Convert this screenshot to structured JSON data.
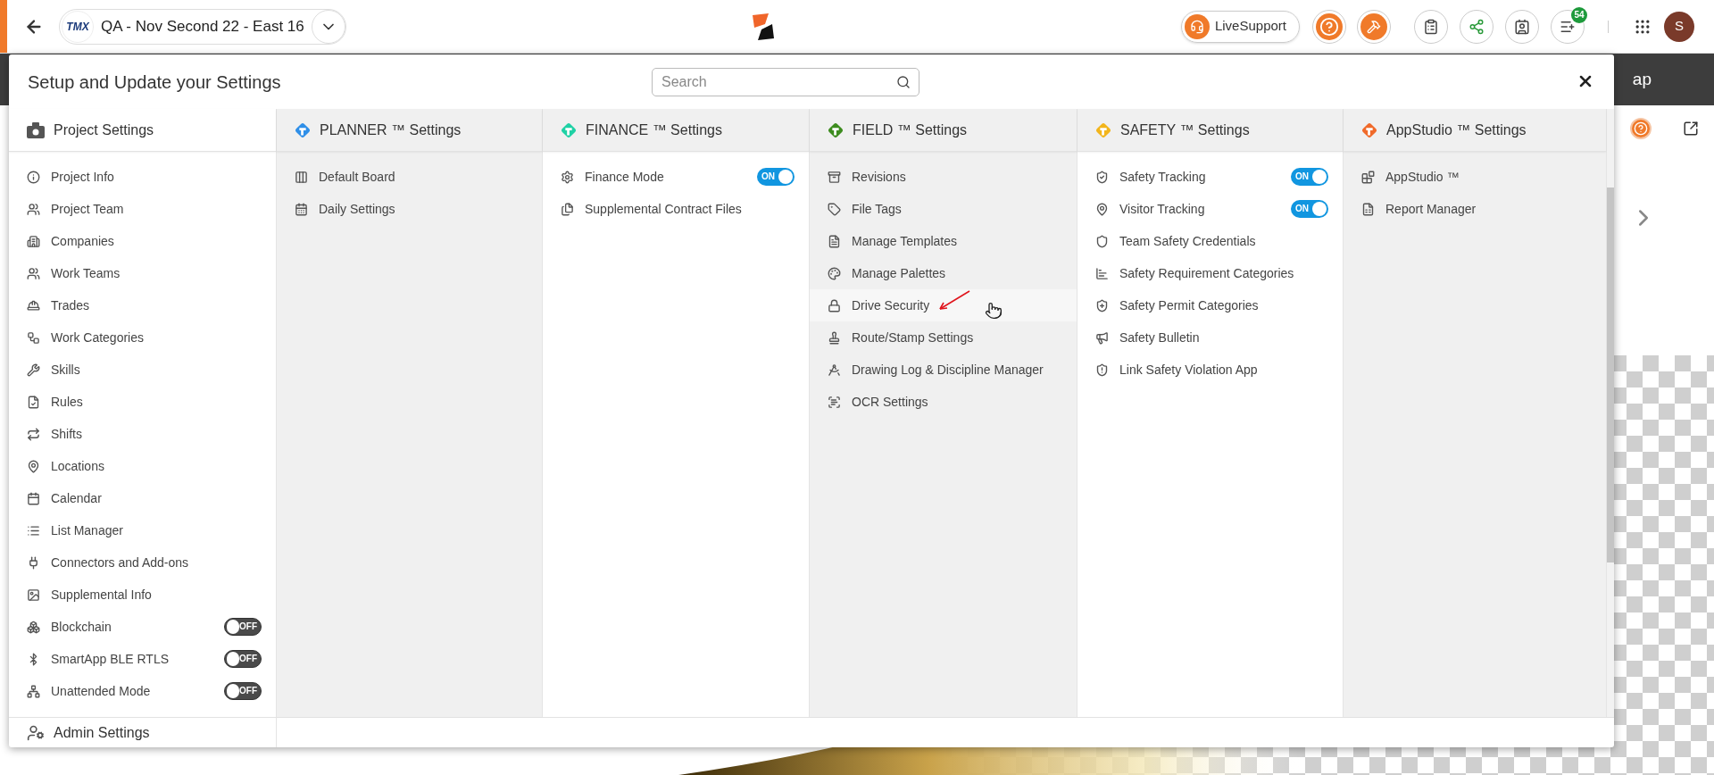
{
  "top_bar": {
    "logo_text": "TMX",
    "project": "QA - Nov Second 22 - East 16",
    "live_support": "LiveSupport",
    "notification_count": "54",
    "avatar_initial": "S"
  },
  "background": {
    "tab_label": "ap"
  },
  "dialog": {
    "title": "Setup and Update your Settings",
    "search": {
      "placeholder": "Search"
    },
    "columns": [
      {
        "title": "Project Settings",
        "kind": "project",
        "color": "#555555",
        "items": [
          {
            "label": "Project Info",
            "kind": "link",
            "hovered": false
          },
          {
            "label": "Project Team",
            "kind": "link",
            "hovered": false
          },
          {
            "label": "Companies",
            "kind": "link",
            "hovered": false
          },
          {
            "label": "Work Teams",
            "kind": "link",
            "hovered": false
          },
          {
            "label": "Trades",
            "kind": "link",
            "hovered": false
          },
          {
            "label": "Work Categories",
            "kind": "link",
            "hovered": false
          },
          {
            "label": "Skills",
            "kind": "link",
            "hovered": false
          },
          {
            "label": "Rules",
            "kind": "link",
            "hovered": false
          },
          {
            "label": "Shifts",
            "kind": "link",
            "hovered": false
          },
          {
            "label": "Locations",
            "kind": "link",
            "hovered": false
          },
          {
            "label": "Calendar",
            "kind": "link",
            "hovered": false
          },
          {
            "label": "List Manager",
            "kind": "link",
            "hovered": false
          },
          {
            "label": "Connectors and Add-ons",
            "kind": "link",
            "hovered": false
          },
          {
            "label": "Supplemental Info",
            "kind": "link",
            "hovered": false
          },
          {
            "label": "Blockchain",
            "kind": "toggle",
            "on": false,
            "toggle_text": "OFF",
            "hovered": false
          },
          {
            "label": "SmartApp BLE RTLS",
            "kind": "toggle",
            "on": false,
            "toggle_text": "OFF",
            "hovered": false
          },
          {
            "label": "Unattended Mode",
            "kind": "toggle",
            "on": false,
            "toggle_text": "OFF",
            "hovered": false
          }
        ]
      },
      {
        "title": "PLANNER ™ Settings",
        "kind": "app",
        "color": "#2f8fe8",
        "items": [
          {
            "label": "Default Board",
            "kind": "link",
            "hovered": false
          },
          {
            "label": "Daily Settings",
            "kind": "link",
            "hovered": false
          }
        ]
      },
      {
        "title": "FINANCE ™ Settings",
        "kind": "app",
        "color": "#1fd1a5",
        "items": [
          {
            "label": "Finance Mode",
            "kind": "toggle",
            "on": true,
            "toggle_text": "ON",
            "hovered": false
          },
          {
            "label": "Supplemental Contract Files",
            "kind": "link",
            "hovered": false
          }
        ]
      },
      {
        "title": "FIELD ™ Settings",
        "kind": "app",
        "color": "#3d8c1f",
        "items": [
          {
            "label": "Revisions",
            "kind": "link",
            "hovered": false
          },
          {
            "label": "File Tags",
            "kind": "link",
            "hovered": false
          },
          {
            "label": "Manage Templates",
            "kind": "link",
            "hovered": false
          },
          {
            "label": "Manage Palettes",
            "kind": "link",
            "hovered": false
          },
          {
            "label": "Drive Security",
            "kind": "link",
            "hovered": true
          },
          {
            "label": "Route/Stamp Settings",
            "kind": "link",
            "hovered": false
          },
          {
            "label": "Drawing Log & Discipline Manager",
            "kind": "link",
            "hovered": false
          },
          {
            "label": "OCR Settings",
            "kind": "link",
            "hovered": false
          }
        ]
      },
      {
        "title": "SAFETY ™ Settings",
        "kind": "app",
        "color": "#f2b51c",
        "items": [
          {
            "label": "Safety Tracking",
            "kind": "toggle",
            "on": true,
            "toggle_text": "ON",
            "hovered": false
          },
          {
            "label": "Visitor Tracking",
            "kind": "toggle",
            "on": true,
            "toggle_text": "ON",
            "hovered": false
          },
          {
            "label": "Team Safety Credentials",
            "kind": "link",
            "hovered": false
          },
          {
            "label": "Safety Requirement Categories",
            "kind": "link",
            "hovered": false
          },
          {
            "label": "Safety Permit Categories",
            "kind": "link",
            "hovered": false
          },
          {
            "label": "Safety Bulletin",
            "kind": "link",
            "hovered": false
          },
          {
            "label": "Link Safety Violation App",
            "kind": "link",
            "hovered": false
          }
        ]
      },
      {
        "title": "AppStudio ™ Settings",
        "kind": "app",
        "color": "#f06a2a",
        "items": [
          {
            "label": "AppStudio ™",
            "kind": "link",
            "hovered": false
          },
          {
            "label": "Report Manager",
            "kind": "link",
            "hovered": false
          }
        ]
      }
    ],
    "footer_section": "Admin Settings"
  }
}
